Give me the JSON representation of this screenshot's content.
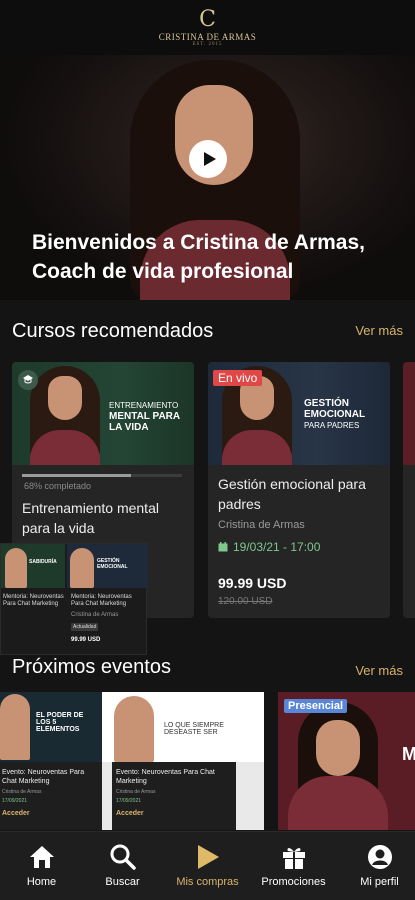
{
  "header": {
    "logo_mark": "C",
    "logo_name": "CRISTINA DE ARMAS",
    "logo_sub": "EST. 2015"
  },
  "hero": {
    "title": "Bienvenidos a Cristina de Armas, Coach de vida profesional"
  },
  "courses_section": {
    "title": "Cursos recomendados",
    "link": "Ver más",
    "cards": [
      {
        "image_text_1": "Entrenamiento",
        "image_text_2": "mental para la vida",
        "progress_fraction": 0.68,
        "progress_label": "68% completado",
        "title": "Entrenamiento mental para la vida"
      },
      {
        "badge": "En vivo",
        "image_text_1": "Gestión emocional",
        "image_text_2": "para padres",
        "title": "Gestión emocional para padres",
        "author": "Cristina de Armas",
        "date": "19/03/21 - 17:00",
        "price": "99.99 USD",
        "old_price": "120.00 USD"
      }
    ]
  },
  "overlay_card": {
    "thumb1_text": "SABIDURÍA",
    "thumb2_text": "GESTIÓN EMOCIONAL",
    "item1_title": "Mentoria: Neuroventas Para Chat Marketing",
    "item2_title": "Mentoria: Neuroventas Para Chat Marketing",
    "item2_author": "Cristina de Armas",
    "item2_tag": "Actualidad",
    "item2_price": "99.99 USD"
  },
  "events_section": {
    "title": "Próximos eventos",
    "link": "Ver más",
    "cards": [
      {
        "image_text": "EL PODER DE LOS 5 ELEMENTOS",
        "title": "Evento: Neuroventas Para Chat Marketing",
        "author": "Cristina de Armas",
        "date": "17/09/2021",
        "action": "Acceder"
      },
      {
        "image_text": "LO QUE SIEMPRE DESEASTE SER",
        "title": "Evento: Neuroventas Para Chat Marketing",
        "author": "Cristina de Armas",
        "date": "17/09/2021",
        "action": "Acceder"
      },
      {
        "badge": "Presencial",
        "image_text": "M"
      }
    ]
  },
  "bottom_nav": {
    "items": [
      {
        "label": "Home",
        "icon": "home-icon"
      },
      {
        "label": "Buscar",
        "icon": "search-icon"
      },
      {
        "label": "Mis compras",
        "icon": "play-icon"
      },
      {
        "label": "Promociones",
        "icon": "gift-icon"
      },
      {
        "label": "Mi perfil",
        "icon": "profile-icon"
      }
    ],
    "active_index": 2
  },
  "colors": {
    "background": "#141414",
    "accent_gold": "#d9b46c",
    "live_badge": "#e04848",
    "presencial_badge": "#5a86d8",
    "date_green": "#7ec88b"
  }
}
